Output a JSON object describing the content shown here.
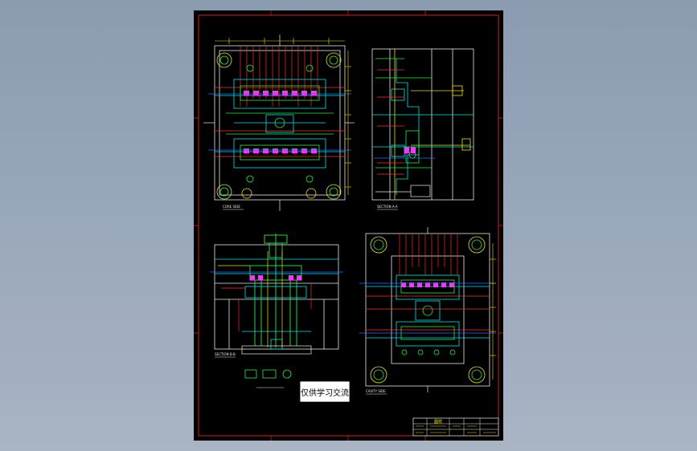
{
  "colors": {
    "background": "#95a4b8",
    "sheet": "#000000",
    "frame": "#cc2222",
    "cyan": "#00e5e5",
    "green": "#22ee44",
    "red": "#ff2a2a",
    "yellow": "#f2e300",
    "magenta": "#ff33ff",
    "white": "#e8e8e8",
    "blue": "#2f6bff"
  },
  "watermark": {
    "text": "仅供学习交流"
  },
  "views": [
    {
      "name": "core-side-view",
      "label": "CORE SIDE"
    },
    {
      "name": "section-view-a",
      "label": "SECTION A-A"
    },
    {
      "name": "section-view-b",
      "label": "SECTION B-B"
    },
    {
      "name": "cavity-side-view",
      "label": "CAVITY SIDE"
    }
  ],
  "title_block": {
    "heading": "图样"
  }
}
